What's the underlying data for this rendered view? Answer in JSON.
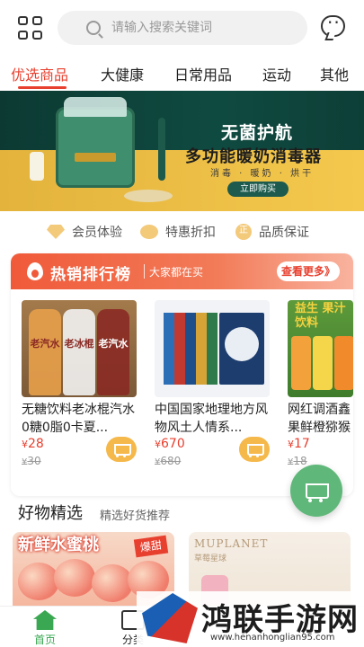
{
  "search": {
    "placeholder": "请输入搜索关键词"
  },
  "tabs": [
    {
      "label": "优选商品",
      "active": true
    },
    {
      "label": "大健康",
      "active": false
    },
    {
      "label": "日常用品",
      "active": false
    },
    {
      "label": "运动",
      "active": false
    },
    {
      "label": "其他",
      "active": false
    }
  ],
  "banner": {
    "title": "无菌护航",
    "subtitle": "多功能暖奶消毒器",
    "tags": "消毒 · 暖奶 · 烘干",
    "cta": "立即购买"
  },
  "perks": [
    {
      "label": "会员体验",
      "icon": "diamond-icon"
    },
    {
      "label": "特惠折扣",
      "icon": "heart-icon"
    },
    {
      "label": "品质保证",
      "icon": "guarantee-icon",
      "glyph": "正"
    }
  ],
  "hot_list": {
    "title": "热销排行榜",
    "subtitle": "大家都在买",
    "more": "查看更多》",
    "products": [
      {
        "name": "无糖饮料老冰棍汽水0糖0脂0卡夏...",
        "price": "28",
        "old_price": "30",
        "currency": "¥"
      },
      {
        "name": "中国国家地理地方风物风土人情系...",
        "price": "670",
        "old_price": "680",
        "currency": "¥"
      },
      {
        "name": "网红调酒鑫果鲜橙猕猴",
        "price": "17",
        "old_price": "18",
        "currency": "¥"
      }
    ],
    "drink_labels": [
      "老汽水",
      "老冰棍",
      "老汽水"
    ],
    "juice_label": "益生 果汁饮料"
  },
  "goods": {
    "title": "好物精选",
    "subtitle": "精选好货推荐",
    "promos": [
      {
        "title": "新鲜水蜜桃",
        "badge": "爆甜"
      },
      {
        "brand": "MUPLANET",
        "brand_cn": "草莓星球"
      }
    ]
  },
  "bottom_nav": [
    {
      "label": "首页",
      "active": true
    },
    {
      "label": "分类",
      "active": false
    }
  ],
  "watermark": {
    "text": "鸿联手游网",
    "url": "www.henanhonglian95.com"
  },
  "colors": {
    "accent": "#e8402f",
    "green": "#3aa852",
    "fab": "#5fb87a",
    "cart": "#f5b84a"
  }
}
